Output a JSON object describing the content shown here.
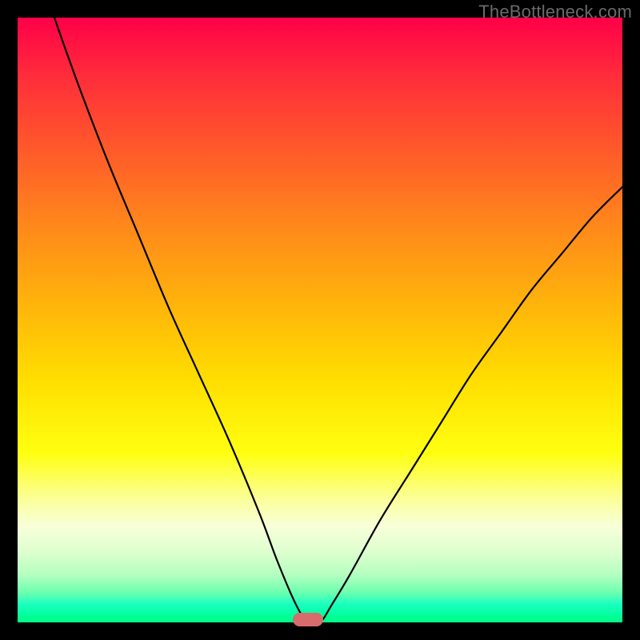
{
  "watermark": "TheBottleneck.com",
  "colors": {
    "frame": "#000000",
    "marker": "#d86b6b",
    "curve": "#000000",
    "gradient_top": "#ff0048",
    "gradient_bottom": "#00ff80"
  },
  "chart_data": {
    "type": "line",
    "title": "",
    "xlabel": "",
    "ylabel": "",
    "xlim": [
      0,
      100
    ],
    "ylim": [
      0,
      100
    ],
    "min_point_x": 48,
    "annotations": [
      {
        "name": "min-marker",
        "x": 48,
        "y": 0
      }
    ],
    "series": [
      {
        "name": "bottleneck-curve",
        "x": [
          0,
          5,
          10,
          15,
          20,
          25,
          30,
          35,
          40,
          43,
          46,
          48,
          50,
          52,
          55,
          60,
          65,
          70,
          75,
          80,
          85,
          90,
          95,
          100
        ],
        "y": [
          117,
          103,
          89,
          76,
          64,
          52,
          41,
          30,
          18,
          10,
          3,
          0,
          0,
          3,
          8,
          17,
          25,
          33,
          41,
          48,
          55,
          61,
          67,
          72
        ]
      }
    ]
  }
}
